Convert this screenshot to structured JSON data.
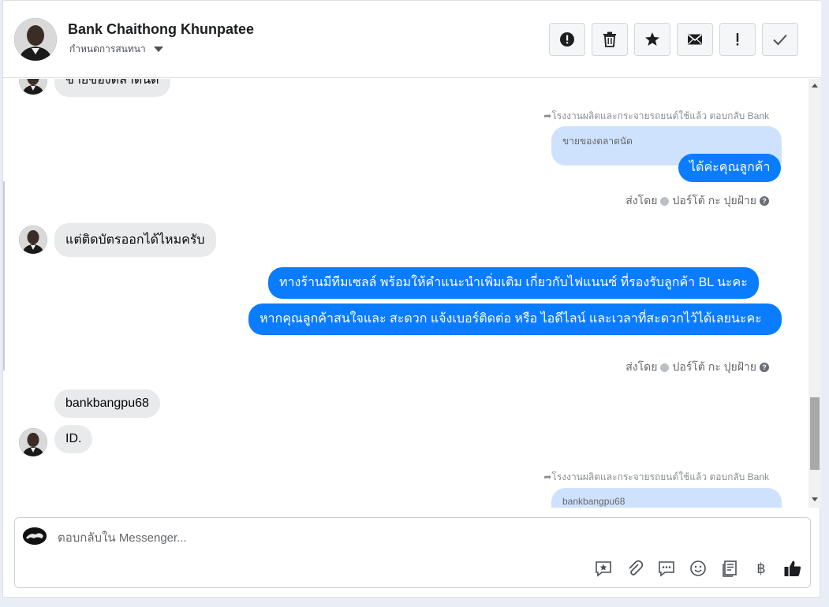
{
  "header": {
    "contact_name": "Bank Chaithong Khunpatee",
    "assign_label": "กำหนดการสนทนา"
  },
  "toolbar": [
    {
      "name": "mark-spam-button",
      "icon": "exclamation-circle-icon"
    },
    {
      "name": "delete-button",
      "icon": "trash-icon"
    },
    {
      "name": "star-button",
      "icon": "star-icon"
    },
    {
      "name": "mark-unread-button",
      "icon": "envelope-icon"
    },
    {
      "name": "mark-important-button",
      "icon": "exclamation-icon"
    },
    {
      "name": "mark-done-button",
      "icon": "check-icon"
    }
  ],
  "messages": {
    "partial_top": "ขายของตลาดนัด",
    "reply1": {
      "meta": "โรงงานผลิตและกระจายรถยนต์ใช้แล้ว ตอบกลับ Bank",
      "quote": "ขายของตลาดนัด",
      "text": "ได้ค่ะคุณลูกค้า",
      "sent_by_prefix": "ส่งโดย",
      "sent_by_name": "ปอร์โต้ กะ ปุยฝ้าย"
    },
    "incoming1": "แต่ติดบัตรออกได้ไหมครับ",
    "outgoing1": "ทางร้านมีทีมเซลล์ พร้อมให้คำแนะนำเพิ่มเติม เกี่ยวกับไฟแนนซ์ ที่รองรับลูกค้า BL นะคะ",
    "outgoing2": "หากคุณลูกค้าสนใจและ สะดวก แจ้งเบอร์ติดต่อ หรือ ไอดีไลน์ และเวลาที่สะดวกไว้ได้เลยนะคะ",
    "sent_by2_prefix": "ส่งโดย",
    "sent_by2_name": "ปอร์โต้ กะ ปุยฝ้าย",
    "incoming2": "bankbangpu68",
    "incoming3": "ID.",
    "reply2": {
      "meta": "โรงงานผลิตและกระจายรถยนต์ใช้แล้ว ตอบกลับ Bank",
      "quote": "bankbangpu68"
    }
  },
  "composer": {
    "placeholder": "ตอบกลับใน Messenger...",
    "tools": [
      "sticker-icon",
      "attachment-icon",
      "saved-replies-icon",
      "emoji-icon",
      "notes-icon",
      "baht-icon",
      "like-icon"
    ],
    "baht_symbol": "฿"
  },
  "colors": {
    "outgoing_bubble": "#0a7cff",
    "incoming_bubble": "#e9eaec",
    "quote_bubble": "#cfe2fd"
  }
}
